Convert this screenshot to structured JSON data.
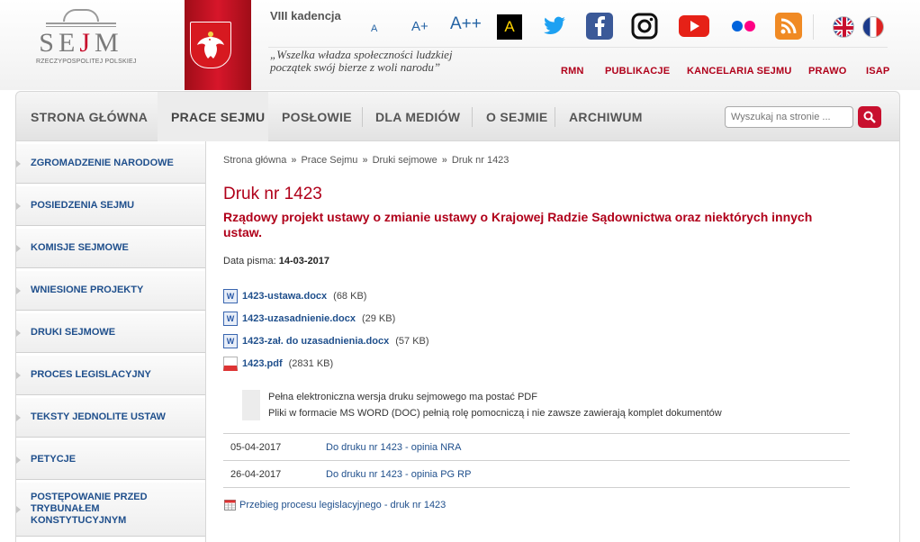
{
  "header": {
    "logo": {
      "word_pre": "SE",
      "word_j": "J",
      "word_post": "M",
      "subtitle": "Rzeczypospolitej Polskiej"
    },
    "kadencja": "VIII kadencja",
    "motto_line1": "„Wszelka władza społeczności ludzkiej",
    "motto_line2": "początek swój bierze z woli narodu”",
    "font_small": "A",
    "font_medium": "A+",
    "font_large": "A++",
    "contrast": "A",
    "top_links": [
      "RMN",
      "PUBLIKACJE",
      "KANCELARIA SEJMU",
      "PRAWO",
      "ISAP"
    ],
    "social_icons": [
      "twitter-icon",
      "facebook-icon",
      "instagram-icon",
      "youtube-icon",
      "flickr-icon",
      "rss-icon"
    ],
    "languages": [
      "english-flag-icon",
      "french-flag-icon"
    ]
  },
  "nav": {
    "items": [
      {
        "label": "STRONA GŁÓWNA",
        "active": false
      },
      {
        "label": "PRACE SEJMU",
        "active": true
      },
      {
        "label": "POSŁOWIE",
        "active": false
      },
      {
        "label": "DLA MEDIÓW",
        "active": false
      },
      {
        "label": "O SEJMIE",
        "active": false
      },
      {
        "label": "ARCHIWUM",
        "active": false
      }
    ],
    "search_placeholder": "Wyszukaj na stronie ..."
  },
  "sidebar": {
    "items": [
      "ZGROMADZENIE NARODOWE",
      "POSIEDZENIA SEJMU",
      "KOMISJE SEJMOWE",
      "WNIESIONE PROJEKTY",
      "DRUKI SEJMOWE",
      "PROCES LEGISLACYJNY",
      "TEKSTY JEDNOLITE USTAW",
      "PETYCJE",
      "POSTĘPOWANIE PRZED TRYBUNAŁEM KONSTYTUCYJNYM"
    ]
  },
  "breadcrumb": [
    "Strona główna",
    "Prace Sejmu",
    "Druki sejmowe",
    "Druk nr 1423"
  ],
  "breadcrumb_sep": "»",
  "main": {
    "title": "Druk nr 1423",
    "subtitle": "Rządowy projekt ustawy o zmianie ustawy o Krajowej Radzie Sądownictwa oraz niektórych innych ustaw.",
    "date_label": "Data pisma:",
    "date_value": "14-03-2017",
    "files": [
      {
        "name": "1423-ustawa.docx",
        "size": "(68 KB)",
        "type": "doc"
      },
      {
        "name": "1423-uzasadnienie.docx",
        "size": "(29 KB)",
        "type": "doc"
      },
      {
        "name": "1423-zał. do uzasadnienia.docx",
        "size": "(57 KB)",
        "type": "doc"
      },
      {
        "name": "1423.pdf",
        "size": "(2831 KB)",
        "type": "pdf"
      }
    ],
    "note_line1": "Pełna elektroniczna wersja druku sejmowego ma postać PDF",
    "note_line2": "Pliki w formacie MS WORD (DOC) pełnią rolę pomocniczą i nie zawsze zawierają komplet dokumentów",
    "opinions": [
      {
        "date": "05-04-2017",
        "link": "Do druku nr 1423 - opinia NRA"
      },
      {
        "date": "26-04-2017",
        "link": "Do druku nr 1423 - opinia PG RP"
      }
    ],
    "process_link": "Przebieg procesu legislacyjnego - druk nr 1423"
  },
  "colors": {
    "accent_red": "#b0001a",
    "link_blue": "#1f4f8c"
  }
}
